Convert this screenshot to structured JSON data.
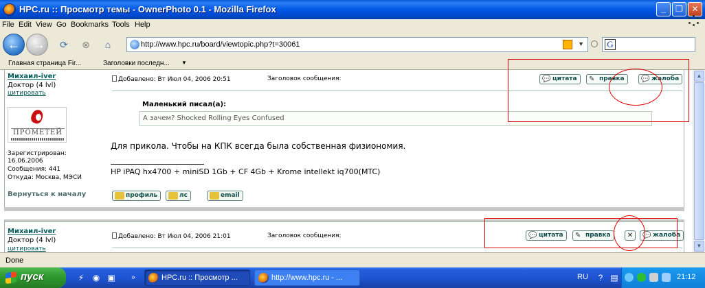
{
  "window": {
    "title": "HPC.ru :: Просмотр темы - OwnerPhoto 0.1 - Mozilla Firefox",
    "min_glyph": "_",
    "max_glyph": "❐",
    "close_glyph": "✕"
  },
  "menu": [
    "File",
    "Edit",
    "View",
    "Go",
    "Bookmarks",
    "Tools",
    "Help"
  ],
  "nav": {
    "url": "http://www.hpc.ru/board/viewtopic.php?t=30061",
    "search_engine": "G"
  },
  "bookmarks": [
    "Главная страница Fir...",
    "Заголовки последн..."
  ],
  "posts": [
    {
      "author": "Михаил-iver",
      "rank": "Доктор (4 lvl)",
      "quote_link": "цитировать",
      "avatar_text": "ПРОМЕТЕЙ",
      "registered_label": "Зарегистрирован:",
      "registered_date": "16.06.2006",
      "messages": "Сообщения: 441",
      "location": "Откуда: Москва, МЭСИ",
      "back_to_top": "Вернуться к началу",
      "posted": "Добавлено: Вт Июл 04, 2006 20:51",
      "subject_label": "Заголовок сообщения:",
      "buttons": [
        "цитата",
        "правка",
        "жалоба"
      ],
      "quote_title": "Маленький писал(а):",
      "quote_text": "А зачем? Shocked Rolling Eyes Confused",
      "body": "Для прикола. Чтобы на КПК всегда была собственная физиономия.",
      "signature": "HP iPAQ hx4700 + miniSD 1Gb + CF 4Gb + Krome intellekt iq700(MTC)",
      "member_buttons": [
        "профиль",
        "лс",
        "email"
      ]
    },
    {
      "author": "Михаил-iver",
      "rank": "Доктор (4 lvl)",
      "quote_link": "цитировать",
      "posted": "Добавлено: Вт Июл 04, 2006 21:01",
      "subject_label": "Заголовок сообщения:",
      "buttons": [
        "цитата",
        "правка",
        "жалоба"
      ],
      "delete_glyph": "✕"
    }
  ],
  "status": {
    "text": "Done"
  },
  "taskbar": {
    "start_label": "пуск",
    "tasks": [
      "HPC.ru :: Просмотр ...",
      "http://www.hpc.ru - ..."
    ],
    "language": "RU",
    "clock": "21:12"
  },
  "icons": {
    "firefox": "firefox-icon",
    "back": "back-arrow-icon",
    "forward": "forward-arrow-icon",
    "reload": "reload-icon",
    "stop": "stop-icon",
    "home": "home-icon",
    "rss": "rss-feed-icon"
  },
  "colors": {
    "annotation_red": "#e00000",
    "forum_link": "#005a5a",
    "titlebar_blue": "#0058e6",
    "taskbar_blue": "#245edb",
    "start_green": "#2f9a2f"
  }
}
